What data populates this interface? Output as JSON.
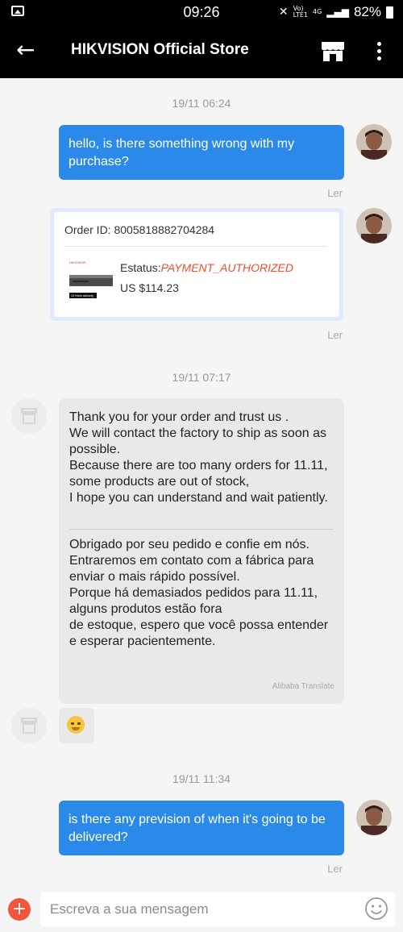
{
  "status_bar": {
    "time": "09:26",
    "network_top": "Vo)",
    "network_bottom": "LTE1",
    "network_type": "4G",
    "battery": "82%"
  },
  "header": {
    "title": "HIKVISION Official Store",
    "icons": [
      "back-arrow-icon",
      "store-icon",
      "more-vertical-icon"
    ]
  },
  "chat": {
    "messages": [
      {
        "timestamp": "19/11 06:24",
        "text": "hello, is there something wrong with my purchase?",
        "read": "Ler"
      },
      {
        "order_id": "Order ID: 8005818882704284",
        "status_label": "Estatus:",
        "status_value": "PAYMENT_AUTHORIZED",
        "price": "US $114.23",
        "thumb_brand": "HIKVISION",
        "thumb_tag": "10 Years warranty",
        "read": "Ler"
      },
      {
        "timestamp": "19/11 07:17",
        "text_en": "Thank you for your order and trust us .\nWe will contact the factory to ship as soon as possible.\nBecause there are too many orders for 11.11, some products are out of stock,\nI hope you can understand and wait patiently.",
        "text_pt": "Obrigado por seu pedido e confie em nós.\nEntraremos em contato com a fábrica para enviar o mais rápido possível.\nPorque há demasiados pedidos para 11.11, alguns produtos estão fora\nde estoque, espero que você possa entender e esperar pacientemente.",
        "translate_note": "Alibaba Translate"
      },
      {
        "emoji": "grinning-face-emoji"
      },
      {
        "timestamp": "19/11 11:34",
        "text": "is there any prevision of when it's going to be delivered?",
        "read": "Ler"
      }
    ]
  },
  "input": {
    "placeholder": "Escreva a sua mensagem",
    "value": ""
  },
  "colors": {
    "outgoing_bubble": "#2b8ae9",
    "incoming_bubble": "#e9e9e9",
    "status_text": "#e8502f",
    "plus_button": "#f1553b"
  }
}
